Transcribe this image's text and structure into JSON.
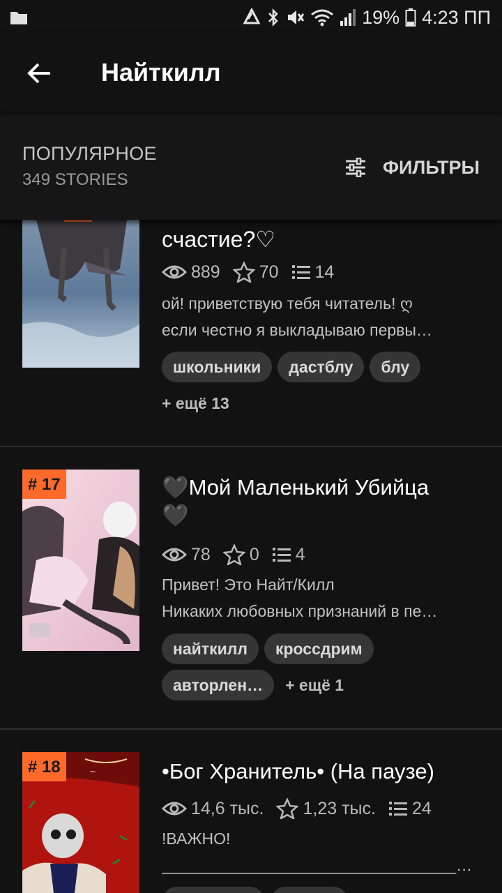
{
  "status_bar": {
    "battery": "19%",
    "time": "4:23 ПП"
  },
  "header": {
    "title": "Найткилл"
  },
  "sort": {
    "label": "ПОПУЛЯРНОЕ",
    "count": "349 STORIES",
    "filters_label": "ФИЛЬТРЫ"
  },
  "stories": [
    {
      "title": "счастие?♡",
      "views": "889",
      "votes": "70",
      "parts": "14",
      "description": [
        "ой! приветствую тебя читатель! ღ",
        " если честно я выкладываю первы…"
      ],
      "tags": [
        "школьники",
        "дастблу",
        "блу"
      ],
      "more": "+ ещё 13"
    },
    {
      "rank": "# 17",
      "title_line1": "🖤Мой Маленький Убийца",
      "title_line2": "🖤",
      "views": "78",
      "votes": "0",
      "parts": "4",
      "description": [
        "Привет! Это Найт/Килл",
        "Никаких любовных признаний в пе…"
      ],
      "tags": [
        "найткилл",
        "кроссдрим",
        "авторлен…"
      ],
      "more": "+ ещё 1"
    },
    {
      "rank": "# 18",
      "title": "•Бог Хранитель• (На паузе)",
      "views": "14,6 тыс.",
      "votes": "1,23 тыс.",
      "parts": "24",
      "description": [
        "!ВАЖНО!",
        "_____________________________________…"
      ]
    }
  ],
  "colors": {
    "background": "#121212",
    "rank_badge": "#ff6a2b",
    "tag_bg": "#363636"
  }
}
